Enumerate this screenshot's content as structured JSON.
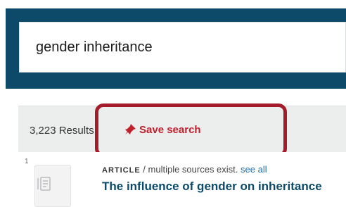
{
  "search": {
    "query": "gender inheritance"
  },
  "results_bar": {
    "count": "3,223 Results",
    "save_search_label": "Save search"
  },
  "result": {
    "number": "1",
    "type": "ARTICLE",
    "sources_text": "/ multiple sources exist.",
    "see_all": "see all",
    "title": "The influence of gender on inheritance"
  },
  "icons": {
    "save": "pushpin-icon",
    "thumbnail": "document-icon"
  },
  "colors": {
    "header": "#0d4a6a",
    "accent": "#c1202d",
    "highlight": "#a41c2b",
    "link": "#1a6fb2"
  }
}
